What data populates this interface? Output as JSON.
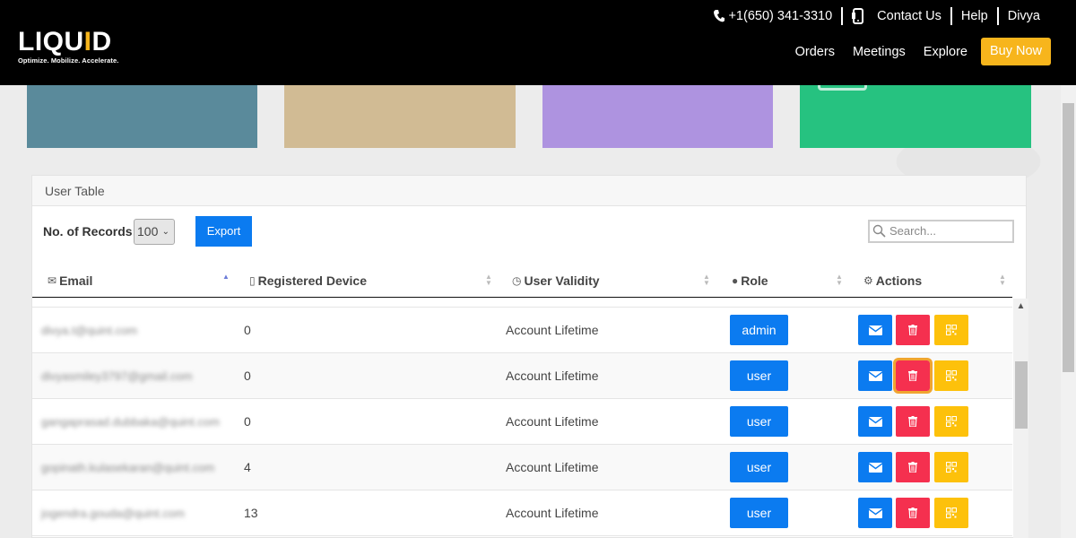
{
  "header": {
    "logo_main": "LIQU",
    "logo_accent": "I",
    "logo_end": "D",
    "logo_tagline": "Optimize. Mobilize. Accelerate.",
    "phone": "+1(650) 341-3310",
    "contact": "Contact Us",
    "help": "Help",
    "user": "Divya",
    "nav": [
      "Orders",
      "Meetings",
      "Explore"
    ],
    "buy_now": "Buy Now"
  },
  "table_panel": {
    "heading": "User Table",
    "records_label": "No. of Records:",
    "records_value": "100",
    "export_label": "Export",
    "search_placeholder": "Search..."
  },
  "columns": {
    "email": "Email",
    "device": "Registered Device",
    "validity": "User Validity",
    "role": "Role",
    "actions": "Actions"
  },
  "rows": [
    {
      "email": "divya.t@quint.com",
      "device": "0",
      "validity": "Account Lifetime",
      "role": "admin"
    },
    {
      "email": "divyasmiley3797@gmail.com",
      "device": "0",
      "validity": "Account Lifetime",
      "role": "user"
    },
    {
      "email": "gangaprasad.dubbaka@quint.com",
      "device": "0",
      "validity": "Account Lifetime",
      "role": "user"
    },
    {
      "email": "gopinath.kulasekaran@quint.com",
      "device": "4",
      "validity": "Account Lifetime",
      "role": "user"
    },
    {
      "email": "jogendra.gouda@quint.com",
      "device": "13",
      "validity": "Account Lifetime",
      "role": "user"
    }
  ],
  "colors": {
    "accent": "#f7b51c",
    "primary": "#0b7bf0",
    "danger": "#f5304f",
    "warning": "#fdc10b"
  }
}
